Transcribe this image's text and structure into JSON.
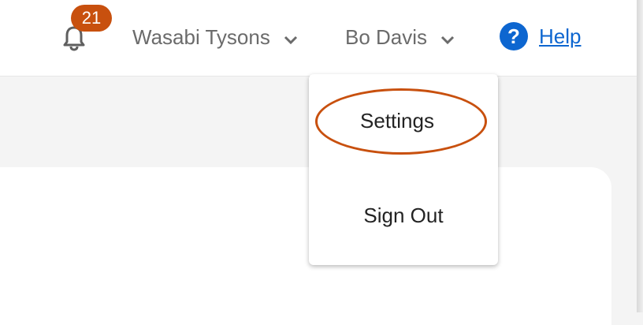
{
  "header": {
    "notifications": {
      "icon": "bell-icon",
      "count": "21",
      "badge_color": "#c8500e"
    },
    "company_menu": {
      "label": "Wasabi Tysons",
      "icon": "chevron-down-icon"
    },
    "user_menu": {
      "label": "Bo Davis",
      "icon": "chevron-down-icon"
    },
    "help": {
      "icon": "question-circle-icon",
      "icon_glyph": "?",
      "label": "Help",
      "color": "#0d66d0"
    }
  },
  "dropdown": {
    "items": [
      {
        "label": "Settings",
        "highlighted": true
      },
      {
        "label": "Sign Out",
        "highlighted": false
      }
    ],
    "highlight_color": "#c8500e"
  }
}
